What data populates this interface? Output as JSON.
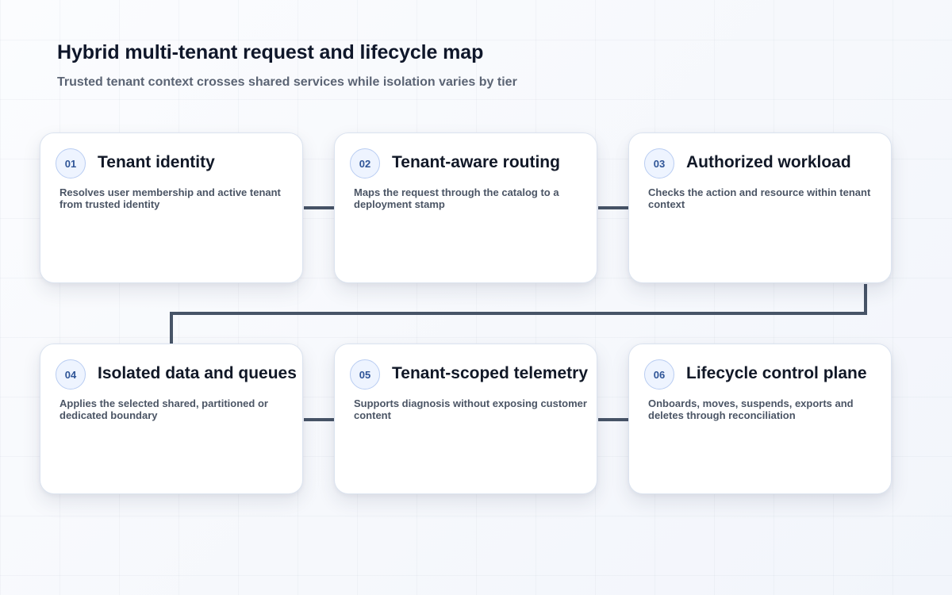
{
  "title": "Hybrid multi-tenant request and lifecycle map",
  "subtitle": "Trusted tenant context crosses shared services while isolation varies by tier",
  "colors": {
    "connector": "#475467",
    "badge_fill": "#eef4ff",
    "badge_border": "#b9cdf2",
    "badge_text": "#2f5597"
  },
  "steps": [
    {
      "number": "01",
      "title": "Tenant identity",
      "description": "Resolves user membership and active tenant from trusted identity"
    },
    {
      "number": "02",
      "title": "Tenant-aware routing",
      "description": "Maps the request through the catalog to a deployment stamp"
    },
    {
      "number": "03",
      "title": "Authorized workload",
      "description": "Checks the action and resource within tenant context"
    },
    {
      "number": "04",
      "title": "Isolated data and queues",
      "description": "Applies the selected shared, partitioned or dedicated boundary"
    },
    {
      "number": "05",
      "title": "Tenant-scoped telemetry",
      "description": "Supports diagnosis without exposing customer content"
    },
    {
      "number": "06",
      "title": "Lifecycle control plane",
      "description": "Onboards, moves, suspends, exports and deletes through reconciliation"
    }
  ]
}
